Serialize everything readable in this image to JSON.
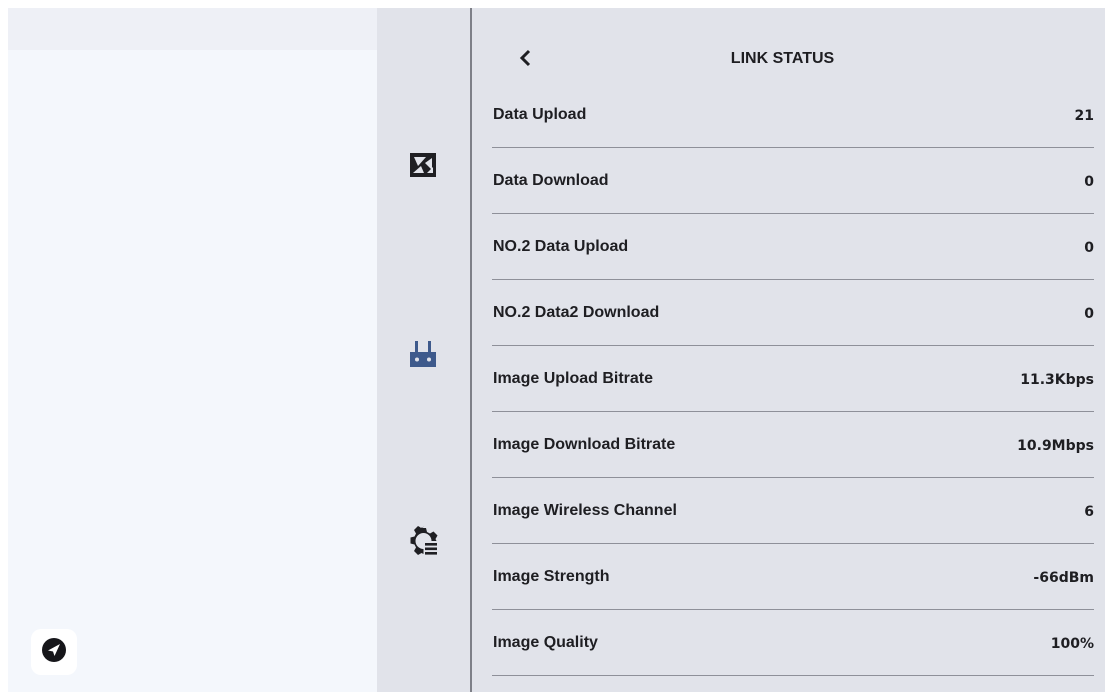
{
  "colors": {
    "rail_bg": "#e1e3ea",
    "panel_bg": "#e1e3ea",
    "left_bg": "#f4f7fc",
    "accent_blue": "#3e5a8c",
    "text": "#1e1e22"
  },
  "rail": {
    "items": [
      {
        "icon": "camera-aperture-icon"
      },
      {
        "icon": "remote-controller-icon"
      },
      {
        "icon": "gear-list-settings-icon"
      }
    ]
  },
  "panel": {
    "title": "LINK STATUS",
    "back_icon": "chevron-left-icon",
    "rows": [
      {
        "label": "Data Upload",
        "value": "21"
      },
      {
        "label": "Data Download",
        "value": "0"
      },
      {
        "label": "NO.2 Data Upload",
        "value": "0"
      },
      {
        "label": "NO.2 Data2 Download",
        "value": "0"
      },
      {
        "label": "Image Upload Bitrate",
        "value": "11.3Kbps"
      },
      {
        "label": "Image Download Bitrate",
        "value": "10.9Mbps"
      },
      {
        "label": "Image Wireless Channel",
        "value": "6"
      },
      {
        "label": "Image Strength",
        "value": "-66dBm"
      },
      {
        "label": "Image Quality",
        "value": "100%"
      }
    ]
  },
  "fab": {
    "icon": "navigation-arrow-icon"
  }
}
